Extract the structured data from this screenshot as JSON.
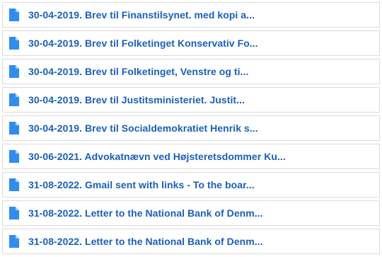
{
  "colors": {
    "link": "#1a5fbf",
    "icon": "#2f8cf2",
    "border": "#dcdcdc"
  },
  "files": [
    {
      "icon": "document-icon",
      "title": "30-04-2019. Brev til Finanstilsynet. med kopi a..."
    },
    {
      "icon": "document-icon",
      "title": "30-04-2019. Brev til Folketinget Konservativ Fo..."
    },
    {
      "icon": "document-icon",
      "title": "30-04-2019. Brev til Folketinget, Venstre og ti..."
    },
    {
      "icon": "document-icon",
      "title": "30-04-2019. Brev til Justitsministeriet. Justit..."
    },
    {
      "icon": "document-icon",
      "title": "30-04-2019. Brev til Socialdemokratiet Henrik s..."
    },
    {
      "icon": "document-icon",
      "title": "30-06-2021. Advokatnævn ved Højsteretsdommer Ku..."
    },
    {
      "icon": "document-icon",
      "title": "31-08-2022. Gmail sent with links - To the boar..."
    },
    {
      "icon": "document-icon",
      "title": "31-08-2022. Letter to the National Bank of Denm..."
    },
    {
      "icon": "document-icon",
      "title": "31-08-2022. Letter to the National Bank of Denm..."
    }
  ]
}
